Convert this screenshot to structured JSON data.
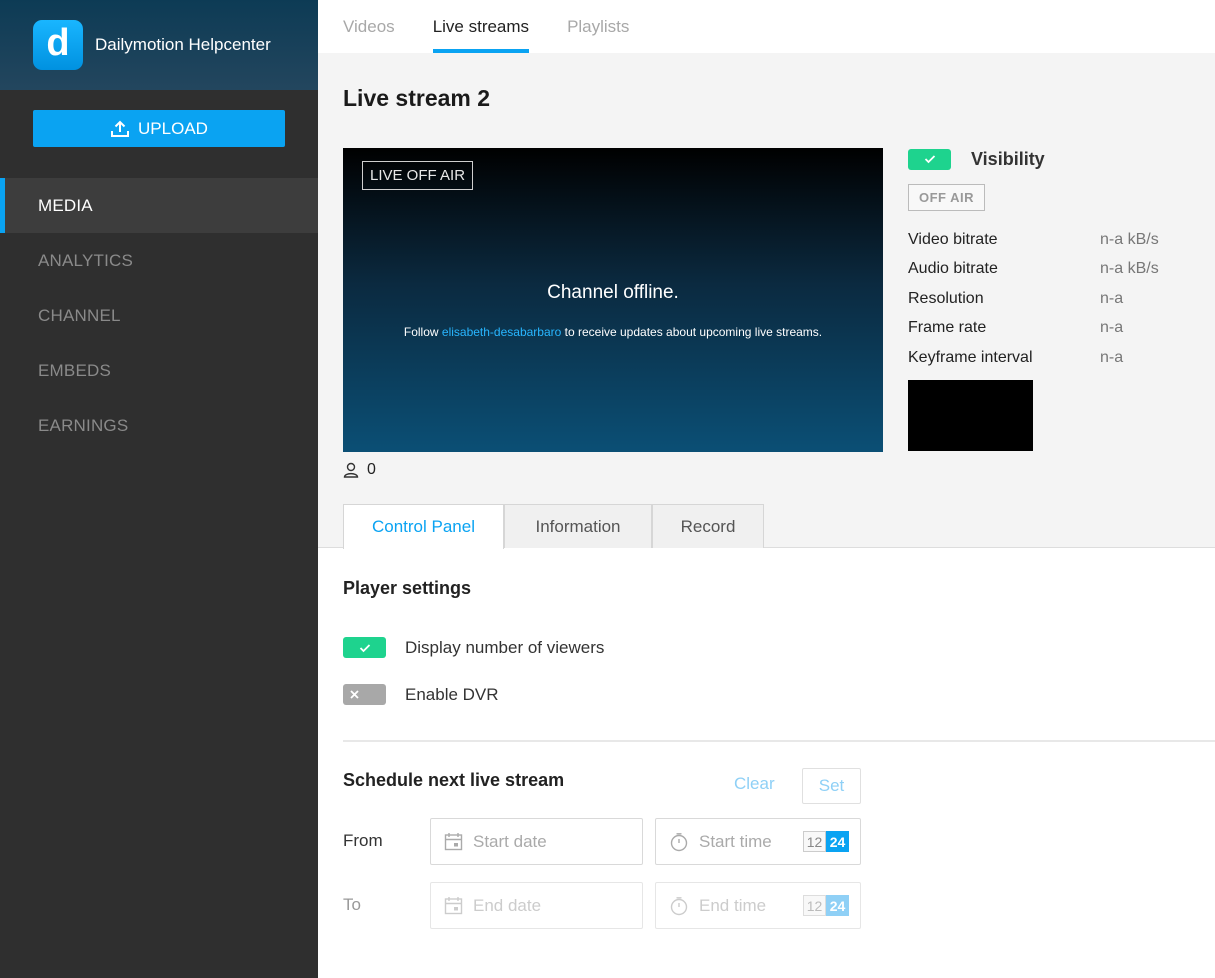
{
  "sidebar": {
    "brand_name": "Dailymotion Helpcenter",
    "logo_letter": "d",
    "upload_label": "UPLOAD",
    "nav": [
      {
        "label": "MEDIA",
        "active": true
      },
      {
        "label": "ANALYTICS",
        "active": false
      },
      {
        "label": "CHANNEL",
        "active": false
      },
      {
        "label": "EMBEDS",
        "active": false
      },
      {
        "label": "EARNINGS",
        "active": false
      }
    ]
  },
  "top_tabs": [
    {
      "label": "Videos",
      "active": false
    },
    {
      "label": "Live streams",
      "active": true
    },
    {
      "label": "Playlists",
      "active": false
    }
  ],
  "stream": {
    "title": "Live stream 2",
    "player": {
      "badge": "LIVE OFF AIR",
      "offline_title": "Channel offline.",
      "msg_prefix": "Follow ",
      "msg_link": "elisabeth-desabarbaro",
      "msg_suffix": " to receive updates about upcoming live streams."
    },
    "viewer_count": "0",
    "visibility_label": "Visibility",
    "visibility_on": true,
    "status_badge": "OFF AIR",
    "stats": [
      {
        "label": "Video bitrate",
        "value": "n-a kB/s"
      },
      {
        "label": "Audio bitrate",
        "value": "n-a kB/s"
      },
      {
        "label": "Resolution",
        "value": "n-a"
      },
      {
        "label": "Frame rate",
        "value": "n-a"
      },
      {
        "label": "Keyframe interval",
        "value": "n-a"
      }
    ]
  },
  "sub_tabs": [
    {
      "label": "Control Panel",
      "active": true
    },
    {
      "label": "Information",
      "active": false
    },
    {
      "label": "Record",
      "active": false
    }
  ],
  "player_settings": {
    "title": "Player settings",
    "items": [
      {
        "label": "Display number of viewers",
        "enabled": true
      },
      {
        "label": "Enable DVR",
        "enabled": false
      }
    ]
  },
  "schedule": {
    "title": "Schedule next live stream",
    "clear_label": "Clear",
    "set_label": "Set",
    "from_label": "From",
    "to_label": "To",
    "start_date_placeholder": "Start date",
    "start_time_placeholder": "Start time",
    "end_date_placeholder": "End date",
    "end_time_placeholder": "End time",
    "format_12": "12",
    "format_24": "24",
    "selected_format": "24"
  },
  "colors": {
    "accent": "#0aa3f2",
    "toggle_on": "#1ed38e",
    "toggle_off": "#a8a8a8",
    "sidebar_bg": "#2f2f2f"
  }
}
